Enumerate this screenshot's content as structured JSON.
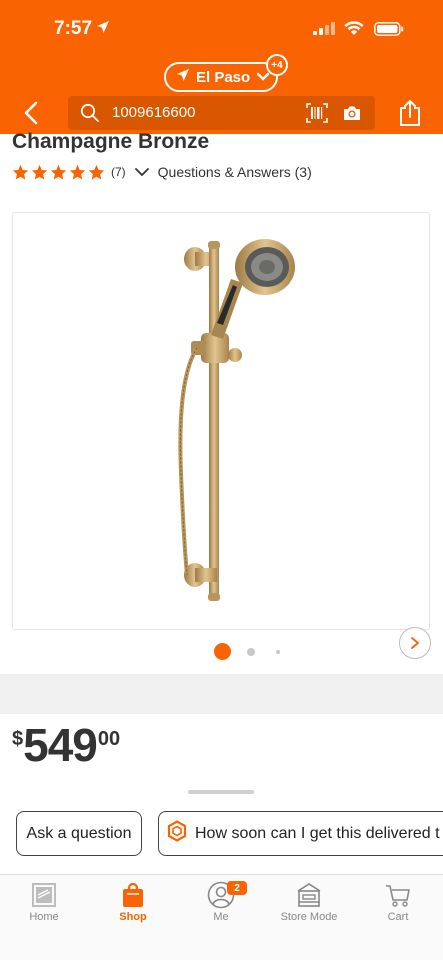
{
  "status_bar": {
    "time": "7:57"
  },
  "header": {
    "location": "El Paso",
    "location_badge": "+4",
    "search_value": "1009616600"
  },
  "product": {
    "title": "Champagne Bronze",
    "rating": 5,
    "review_count": "(7)",
    "qa_label": "Questions & Answers (3)",
    "image_count": 3,
    "current_image": 1
  },
  "price": {
    "symbol": "$",
    "dollars": "549",
    "cents": "00"
  },
  "chips": {
    "ask": "Ask a question",
    "delivery": "How soon can I get this delivered t"
  },
  "nav": {
    "home": "Home",
    "shop": "Shop",
    "me": "Me",
    "me_badge": "2",
    "store_mode": "Store Mode",
    "cart": "Cart"
  },
  "colors": {
    "brand": "#f96302",
    "bronze": "#c9a56b",
    "text": "#222222"
  }
}
